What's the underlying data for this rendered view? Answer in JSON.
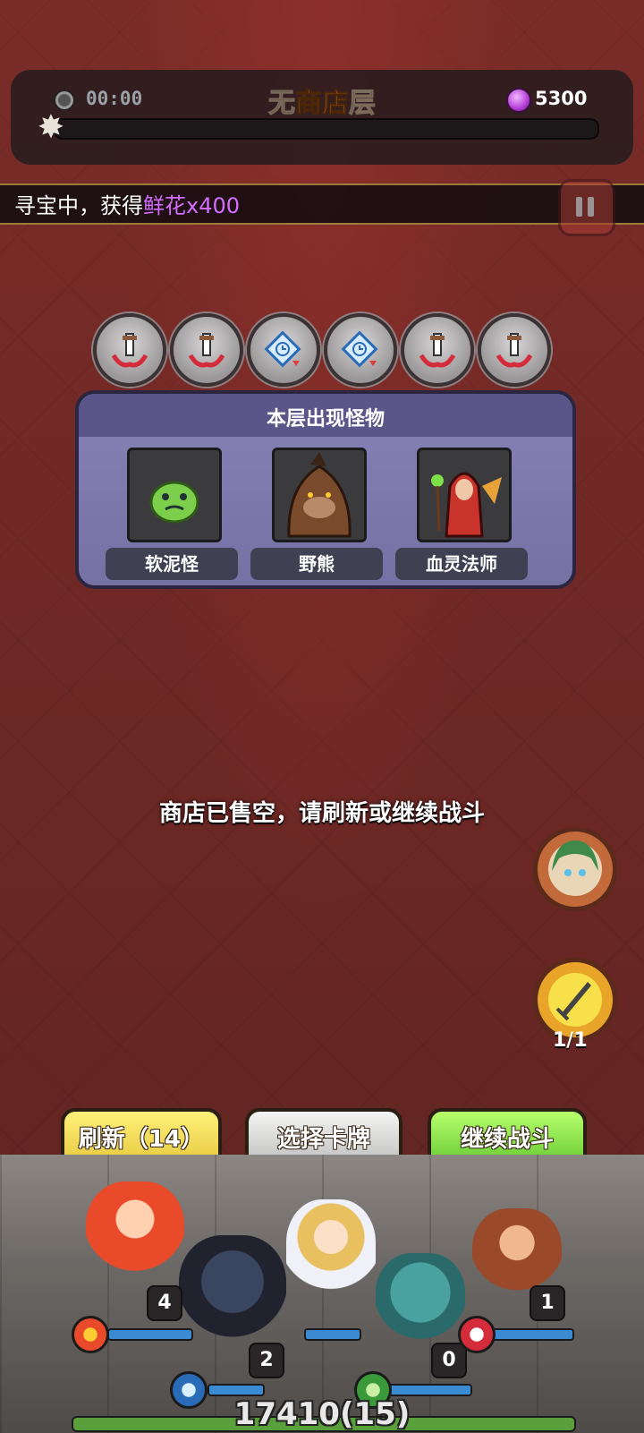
{
  "hud": {
    "timer": "00:00",
    "title_left": "无",
    "title_main": "商店",
    "title_right": "层",
    "currency_amount": "5300",
    "currency_icon": "gem-icon",
    "progress_fraction": 0.0
  },
  "ticker": {
    "prefix": "寻宝中，获得",
    "reward": "鲜花x400",
    "reward_color": "#d36cff"
  },
  "relics": [
    {
      "icon": "sword-horns-relic-icon"
    },
    {
      "icon": "sword-horns-relic-icon"
    },
    {
      "icon": "clock-card-relic-icon"
    },
    {
      "icon": "clock-card-relic-icon"
    },
    {
      "icon": "sword-horns-relic-icon"
    },
    {
      "icon": "sword-horns-relic-icon"
    }
  ],
  "monster_panel": {
    "title": "本层出现怪物",
    "monsters": [
      {
        "name": "软泥怪",
        "icon": "slime-icon",
        "color": "#7ccf4a"
      },
      {
        "name": "野熊",
        "icon": "bear-icon",
        "color": "#7a4a2c"
      },
      {
        "name": "血灵法师",
        "icon": "blood-mage-icon",
        "color": "#c8332c"
      }
    ]
  },
  "message": "商店已售空，请刷新或继续战斗",
  "skill": {
    "count": "1/1"
  },
  "buttons": {
    "refresh": "刷新（14）",
    "choose_cards": "选择卡牌",
    "continue_battle": "继续战斗"
  },
  "heroes": [
    {
      "name": "fire-hero",
      "stars": "4"
    },
    {
      "name": "dark-knight",
      "stars": "2"
    },
    {
      "name": "priestess",
      "stars": ""
    },
    {
      "name": "owl-druid",
      "stars": "0"
    },
    {
      "name": "monkey-king",
      "stars": "1"
    }
  ],
  "team_power": "17410(15)",
  "colors": {
    "accent_orange": "#f4a23c",
    "refresh_yellow": "#e6c73a",
    "continue_green": "#62c72e",
    "panel_purple": "#7571a3"
  }
}
